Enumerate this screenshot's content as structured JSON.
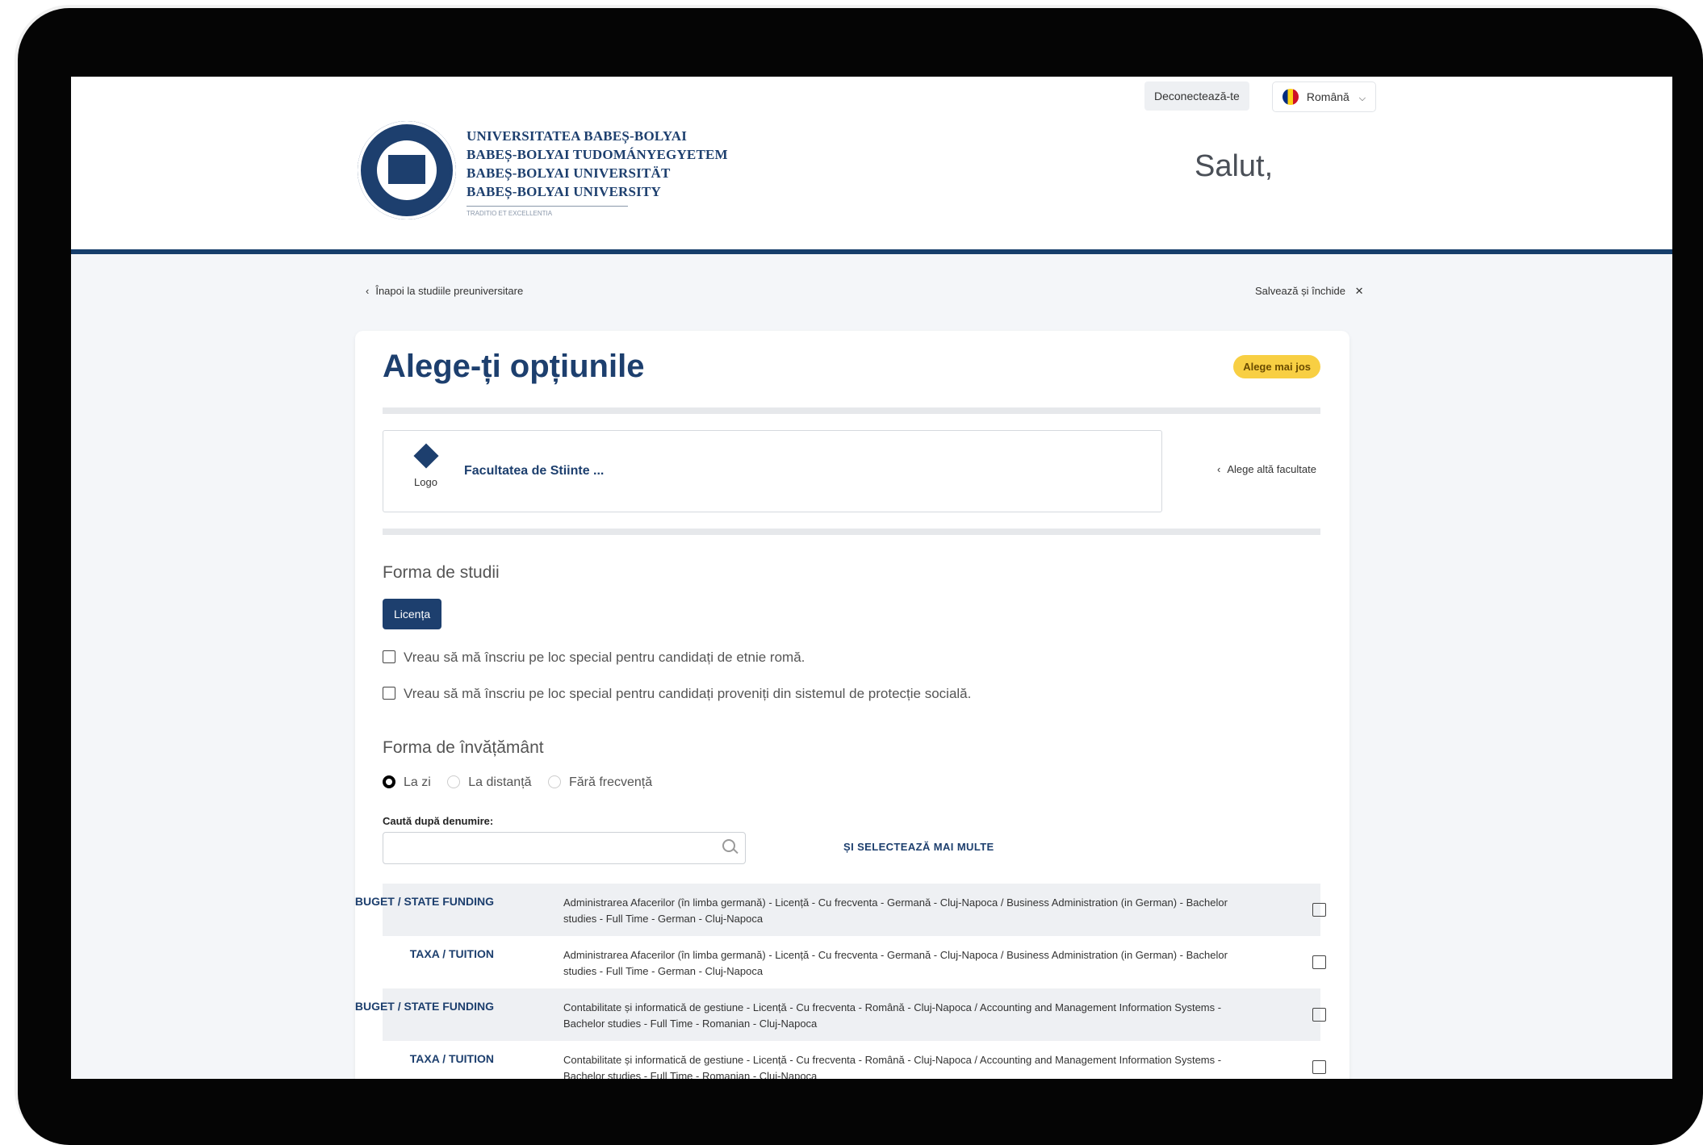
{
  "header": {
    "logout_label": "Deconectează-te",
    "language_label": "Română",
    "greeting": "Salut,",
    "university_lines": [
      "UNIVERSITATEA BABEȘ-BOLYAI",
      "BABEȘ-BOLYAI TUDOMÁNYEGYETEM",
      "BABEȘ-BOLYAI UNIVERSITÄT",
      "BABEȘ-BOLYAI UNIVERSITY"
    ],
    "motto": "TRADITIO ET EXCELLENTIA"
  },
  "nav": {
    "back_label": "Înapoi la studiile preuniversitare",
    "save_close_label": "Salvează și închide"
  },
  "main": {
    "title": "Alege-ți opțiunile",
    "badge": "Alege mai jos",
    "faculty": {
      "logo_label": "Logo",
      "name": "Facultatea de Stiinte ...",
      "change_label": "Alege altă facultate"
    },
    "study_form": {
      "label": "Forma de studii",
      "selected": "Licența"
    },
    "special": [
      "Vreau să mă înscriu pe loc special pentru candidați de etnie romă.",
      "Vreau să mă înscriu pe loc special pentru candidați proveniți din sistemul de protecție socială."
    ],
    "education_form": {
      "label": "Forma de învățământ",
      "options": [
        "La zi",
        "La distanță",
        "Fără frecvență"
      ],
      "selected": "La zi"
    },
    "search": {
      "label": "Caută după denumire:",
      "value": "",
      "multi_label": "ȘI SELECTEAZĂ MAI MULTE"
    },
    "programs": [
      {
        "funding": "BUGET / STATE FUNDING",
        "name": "Administrarea Afacerilor (în limba germană) - Licență - Cu frecventa - Germană - Cluj-Napoca / Business Administration (in German) - Bachelor studies - Full Time - German - Cluj-Napoca"
      },
      {
        "funding": "TAXA / TUITION",
        "name": "Administrarea Afacerilor (în limba germană) - Licență - Cu frecventa - Germană - Cluj-Napoca / Business Administration (in German) - Bachelor studies - Full Time - German - Cluj-Napoca"
      },
      {
        "funding": "BUGET / STATE FUNDING",
        "name": "Contabilitate și informatică de gestiune - Licență - Cu frecventa - Română - Cluj-Napoca / Accounting and Management Information Systems - Bachelor studies - Full Time - Romanian - Cluj-Napoca"
      },
      {
        "funding": "TAXA / TUITION",
        "name": "Contabilitate și informatică de gestiune - Licență - Cu frecventa - Română - Cluj-Napoca / Accounting and Management Information Systems - Bachelor studies - Full Time - Romanian - Cluj-Napoca"
      }
    ]
  }
}
